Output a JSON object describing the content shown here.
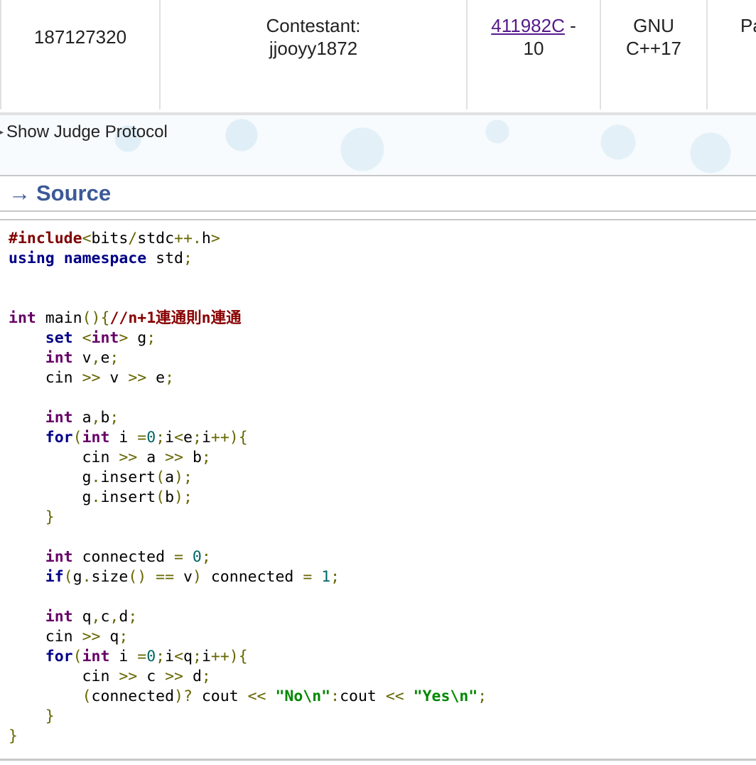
{
  "submission": {
    "id": "187127320",
    "party_line1": "Contestant:",
    "party_line2": "jjooyy1872",
    "problem_link": "411982C",
    "problem_dash": " -",
    "problem_index": "10",
    "lang_line1": "GNU",
    "lang_line2": "C++17",
    "next_col_partial": "Pa"
  },
  "judge_protocol": {
    "label": "Show Judge Protocol"
  },
  "source": {
    "arrow": "→",
    "title": "Source",
    "code_lines": [
      "#include<bits/stdc++.h>",
      "using namespace std;",
      "",
      "",
      "int main(){//n+1連通則n連通",
      "    set <int> g;",
      "    int v,e;",
      "    cin >> v >> e;",
      "",
      "    int a,b;",
      "    for(int i =0;i<e;i++){",
      "        cin >> a >> b;",
      "        g.insert(a);",
      "        g.insert(b);",
      "    }",
      "",
      "    int connected = 0;",
      "    if(g.size() == v) connected = 1;",
      "",
      "    int q,c,d;",
      "    cin >> q;",
      "    for(int i =0;i<q;i++){",
      "        cin >> c >> d;",
      "        (connected)? cout << \"No\\n\":cout << \"Yes\\n\";",
      "    }",
      "}"
    ]
  }
}
